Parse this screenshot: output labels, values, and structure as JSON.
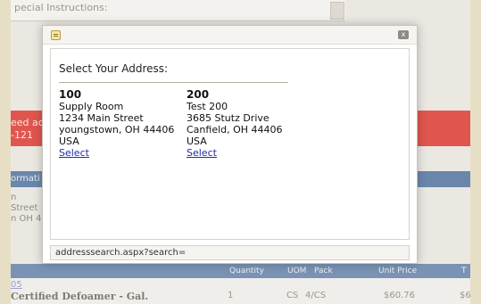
{
  "background": {
    "instructions_text": "pecial Instructions:",
    "alert_lines": [
      "eed ac",
      "-121"
    ],
    "section_bar": "ormati",
    "address_lines": [
      "n",
      "Street",
      "n OH 4"
    ],
    "table_headers": [
      "Quantity",
      "UOM",
      "Pack",
      "Unit Price",
      "T"
    ],
    "row_link": "05",
    "row_product": "Certified Defoamer - Gal.",
    "row_qty": "1",
    "row_uom": "CS",
    "row_pack": "4/CS",
    "row_price": "$60.76",
    "row_total": "$6"
  },
  "modal": {
    "heading": "Select Your Address:",
    "close_glyph": "x",
    "addresses": [
      {
        "id": "100",
        "name": "Supply Room",
        "street": "1234 Main Street",
        "city": "youngstown, OH 44406",
        "country": "USA",
        "link": "Select"
      },
      {
        "id": "200",
        "name": "Test 200",
        "street": "3685 Stutz Drive",
        "city": "Canfield, OH 44406",
        "country": "USA",
        "link": "Select"
      }
    ],
    "status": "addresssearch.aspx?search="
  },
  "colors": {
    "alert": "#e0564e",
    "section": "#6a87ab",
    "link": "#1f2bb0"
  }
}
